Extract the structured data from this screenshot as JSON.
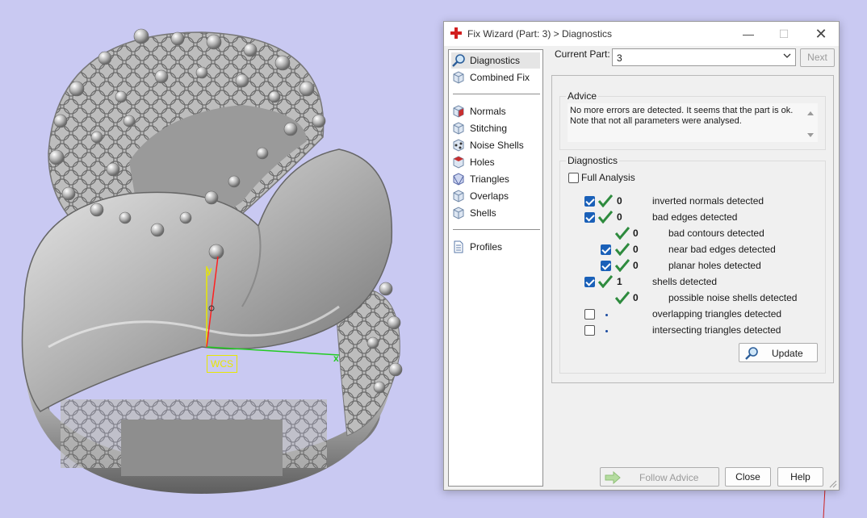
{
  "viewport": {
    "wcs_label": "WCS",
    "axis_y_label": "y",
    "axis_x_label": "x",
    "background_color": "#c9c9f2"
  },
  "dialog": {
    "title": "Fix Wizard (Part: 3) > Diagnostics",
    "nav": {
      "group1": [
        {
          "label": "Diagnostics",
          "icon": "magnifier-icon",
          "selected": true
        },
        {
          "label": "Combined Fix",
          "icon": "cube-icon",
          "selected": false
        }
      ],
      "group2": [
        {
          "label": "Normals",
          "icon": "normals-cube-icon"
        },
        {
          "label": "Stitching",
          "icon": "stitching-cube-icon"
        },
        {
          "label": "Noise Shells",
          "icon": "noise-shells-cube-icon"
        },
        {
          "label": "Holes",
          "icon": "holes-cube-icon"
        },
        {
          "label": "Triangles",
          "icon": "triangles-cube-icon"
        },
        {
          "label": "Overlaps",
          "icon": "overlaps-cube-icon"
        },
        {
          "label": "Shells",
          "icon": "shells-cube-icon"
        }
      ],
      "group3": [
        {
          "label": "Profiles",
          "icon": "document-icon"
        }
      ]
    },
    "current_part_label": "Current Part:",
    "current_part_value": "3",
    "next_label": "Next",
    "advice": {
      "title": "Advice",
      "line1": "No more errors are detected. It seems that the part is ok.",
      "line2": "Note that not all parameters were analysed."
    },
    "diagnostics": {
      "title": "Diagnostics",
      "full_analysis_label": "Full Analysis",
      "full_analysis_checked": false,
      "rows": [
        {
          "checkbox": true,
          "checked": true,
          "status": "ok",
          "count": "0",
          "text": "inverted normals detected",
          "indent": 0
        },
        {
          "checkbox": true,
          "checked": true,
          "status": "ok",
          "count": "0",
          "text": "bad edges detected",
          "indent": 0
        },
        {
          "checkbox": false,
          "checked": false,
          "status": "ok",
          "count": "0",
          "text": "bad contours detected",
          "indent": 1
        },
        {
          "checkbox": true,
          "checked": true,
          "status": "ok",
          "count": "0",
          "text": "near bad edges detected",
          "indent": 1
        },
        {
          "checkbox": true,
          "checked": true,
          "status": "ok",
          "count": "0",
          "text": "planar holes detected",
          "indent": 1
        },
        {
          "checkbox": true,
          "checked": true,
          "status": "ok",
          "count": "1",
          "text": "shells detected",
          "indent": 0
        },
        {
          "checkbox": false,
          "checked": false,
          "status": "ok",
          "count": "0",
          "text": "possible noise shells detected",
          "indent": 1
        },
        {
          "checkbox": true,
          "checked": false,
          "status": "pending",
          "count": "",
          "text": "overlapping triangles detected",
          "indent": 0
        },
        {
          "checkbox": true,
          "checked": false,
          "status": "pending",
          "count": "",
          "text": "intersecting triangles detected",
          "indent": 0
        }
      ],
      "update_label": "Update"
    },
    "follow_advice_label": "Follow Advice",
    "close_label": "Close",
    "help_label": "Help"
  },
  "colors": {
    "check_green": "#2e8b3e",
    "checkbox_blue": "#1a60b8",
    "app_icon_red": "#d21f1f"
  }
}
